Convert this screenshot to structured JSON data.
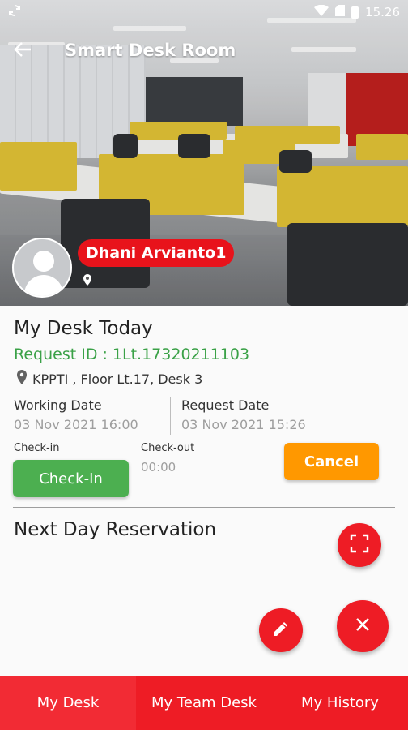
{
  "status_bar": {
    "time": "15.26"
  },
  "header": {
    "title": "Smart Desk Room"
  },
  "profile": {
    "name": "Dhani Arvianto1"
  },
  "my_desk": {
    "heading": "My Desk Today",
    "request_id": "Request ID : 1Lt.17320211103",
    "location": "KPPTI  , Floor Lt.17, Desk 3",
    "working_date_label": "Working Date",
    "working_date_value": "03 Nov 2021 16:00",
    "request_date_label": "Request Date",
    "request_date_value": "03 Nov 2021 15:26",
    "checkin_label": "Check-in",
    "checkout_label": "Check-out",
    "checkout_value": "00:00",
    "checkin_button": "Check-In",
    "cancel_button": "Cancel"
  },
  "next_day": {
    "heading": "Next Day Reservation"
  },
  "bottom_nav": {
    "tabs": [
      {
        "label": "My Desk"
      },
      {
        "label": "My Team Desk"
      },
      {
        "label": "My History"
      }
    ]
  },
  "colors": {
    "primary": "#ee1c25",
    "green": "#4caf50",
    "orange": "#ff9800"
  },
  "icons": [
    "sync-icon",
    "wifi-icon",
    "sim-icon",
    "battery-icon",
    "back-arrow-icon",
    "location-pin-icon",
    "scan-icon",
    "edit-icon",
    "close-icon"
  ]
}
